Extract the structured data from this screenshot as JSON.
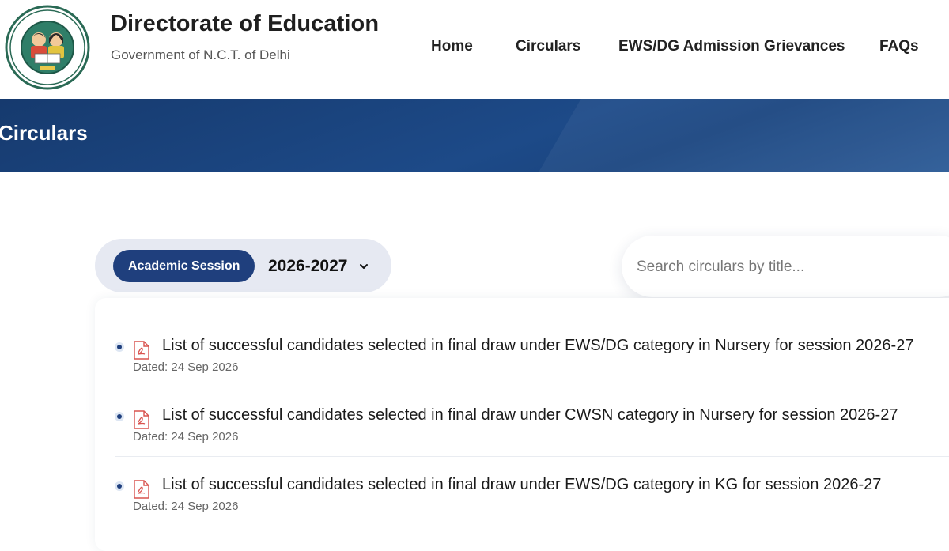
{
  "header": {
    "title": "Directorate of Education",
    "subtitle": "Government of N.C.T. of Delhi",
    "logo_icon": "education-department-seal-icon",
    "nav": {
      "home": "Home",
      "circulars": "Circulars",
      "ews": "EWS/DG Admission Grievances",
      "faqs": "FAQs"
    }
  },
  "banner": {
    "title": "Circulars"
  },
  "filter": {
    "session_badge": "Academic Session",
    "session_value": "2026-2027"
  },
  "search": {
    "placeholder": "Search circulars by title..."
  },
  "circulars": [
    {
      "title": "List of successful candidates selected in final draw under EWS/DG category in Nursery for session 2026-27",
      "date": "Dated: 24 Sep 2026"
    },
    {
      "title": "List of successful candidates selected in final draw under CWSN category in Nursery for session 2026-27",
      "date": "Dated: 24 Sep 2026"
    },
    {
      "title": "List of successful candidates selected in final draw under EWS/DG category in KG for session 2026-27",
      "date": "Dated: 24 Sep 2026"
    }
  ],
  "colors": {
    "primary": "#1f3f7d",
    "banner": "#1d4a88",
    "pill": "#e6e9f2"
  }
}
